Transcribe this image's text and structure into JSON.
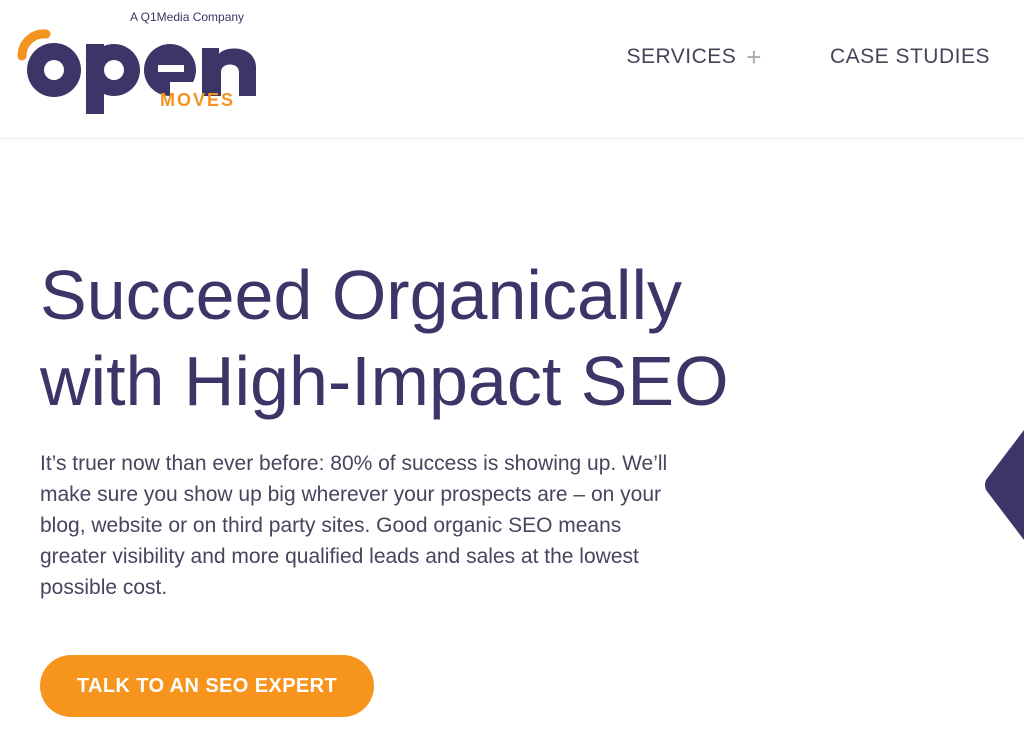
{
  "header": {
    "tagline": "A Q1Media Company",
    "logo_word": "open",
    "logo_sub": "MOVES",
    "nav": [
      {
        "label": "SERVICES",
        "icon": "plus-icon",
        "icon_glyph": "+"
      },
      {
        "label": "CASE STUDIES"
      }
    ]
  },
  "hero": {
    "title_line1": "Succeed Organically",
    "title_line2": "with High-Impact SEO",
    "body": "It’s truer now than ever before: 80% of success is showing up. We’ll make sure you show up big wherever your prospects are – on your blog, website or on third party sites. Good organic SEO means greater visibility and more qualified leads and sales at the lowest possible cost.",
    "cta_label": "TALK TO AN SEO EXPERT"
  },
  "colors": {
    "brand_purple": "#3b3568",
    "brand_orange": "#f7941d",
    "text_gray": "#45425a"
  }
}
